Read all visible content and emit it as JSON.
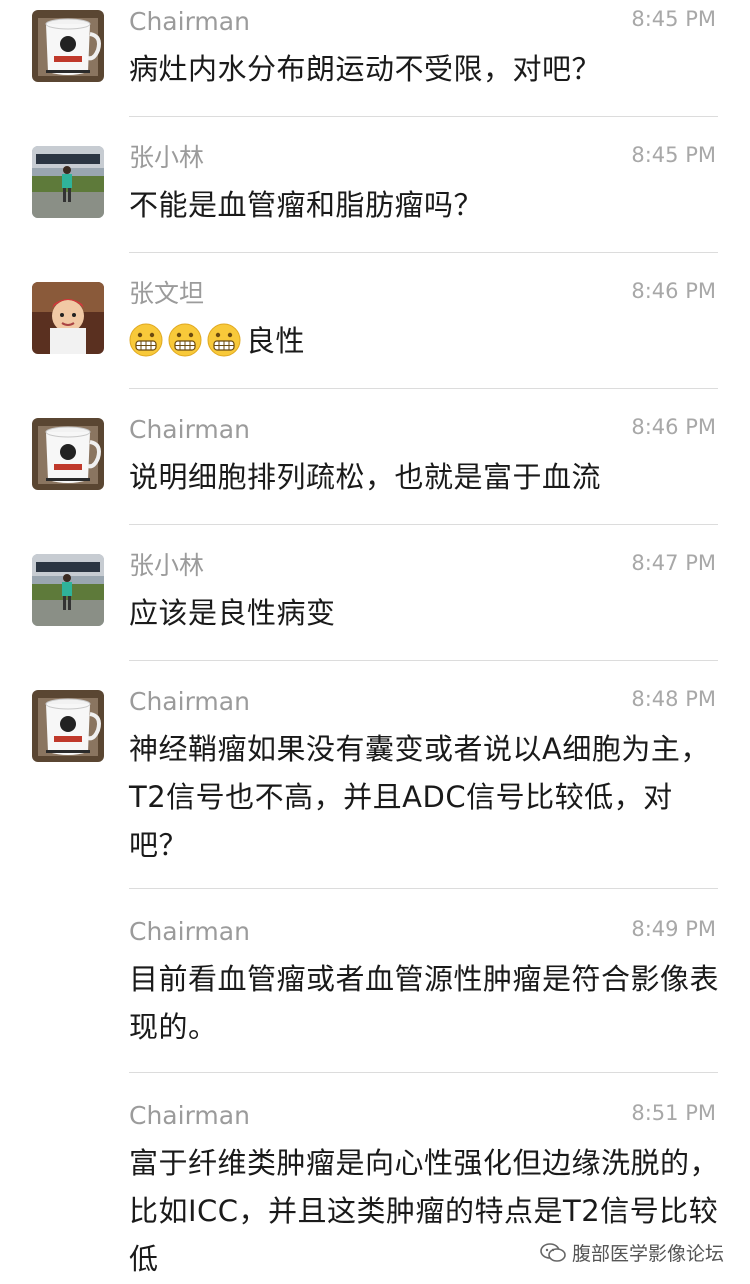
{
  "messages": [
    {
      "sender": "Chairman",
      "time": "8:45 PM",
      "avatar": "mug-avatar",
      "text": "病灶内水分布朗运动不受限，对吧？"
    },
    {
      "sender": "张小林",
      "time": "8:45 PM",
      "avatar": "landscape-avatar",
      "text": "不能是血管瘤和脂肪瘤吗？"
    },
    {
      "sender": "张文坦",
      "time": "8:46 PM",
      "avatar": "child-avatar",
      "emojis": [
        "grimace-emoji",
        "grimace-emoji",
        "grimace-emoji"
      ],
      "text": "良性"
    },
    {
      "sender": "Chairman",
      "time": "8:46 PM",
      "avatar": "mug-avatar",
      "text": "说明细胞排列疏松，也就是富于血流"
    },
    {
      "sender": "张小林",
      "time": "8:47 PM",
      "avatar": "landscape-avatar",
      "text": "应该是良性病变"
    },
    {
      "sender": "Chairman",
      "time": "8:48 PM",
      "avatar": "mug-avatar",
      "text": "神经鞘瘤如果没有囊变或者说以A细胞为主，T2信号也不高，并且ADC信号比较低，对吧？"
    },
    {
      "sender": "Chairman",
      "time": "8:49 PM",
      "avatar": "none",
      "text": "目前看血管瘤或者血管源性肿瘤是符合影像表现的。"
    },
    {
      "sender": "Chairman",
      "time": "8:51 PM",
      "avatar": "none",
      "text": "富于纤维类肿瘤是向心性强化但边缘洗脱的，比如ICC，并且这类肿瘤的特点是T2信号比较低"
    }
  ],
  "watermark": {
    "icon": "wechat-official-account-icon",
    "label": "腹部医学影像论坛"
  },
  "colors": {
    "sender": "#9b9b9b",
    "time": "#a8a8a8",
    "text": "#1a1a1a",
    "divider": "#dcdcdc"
  }
}
